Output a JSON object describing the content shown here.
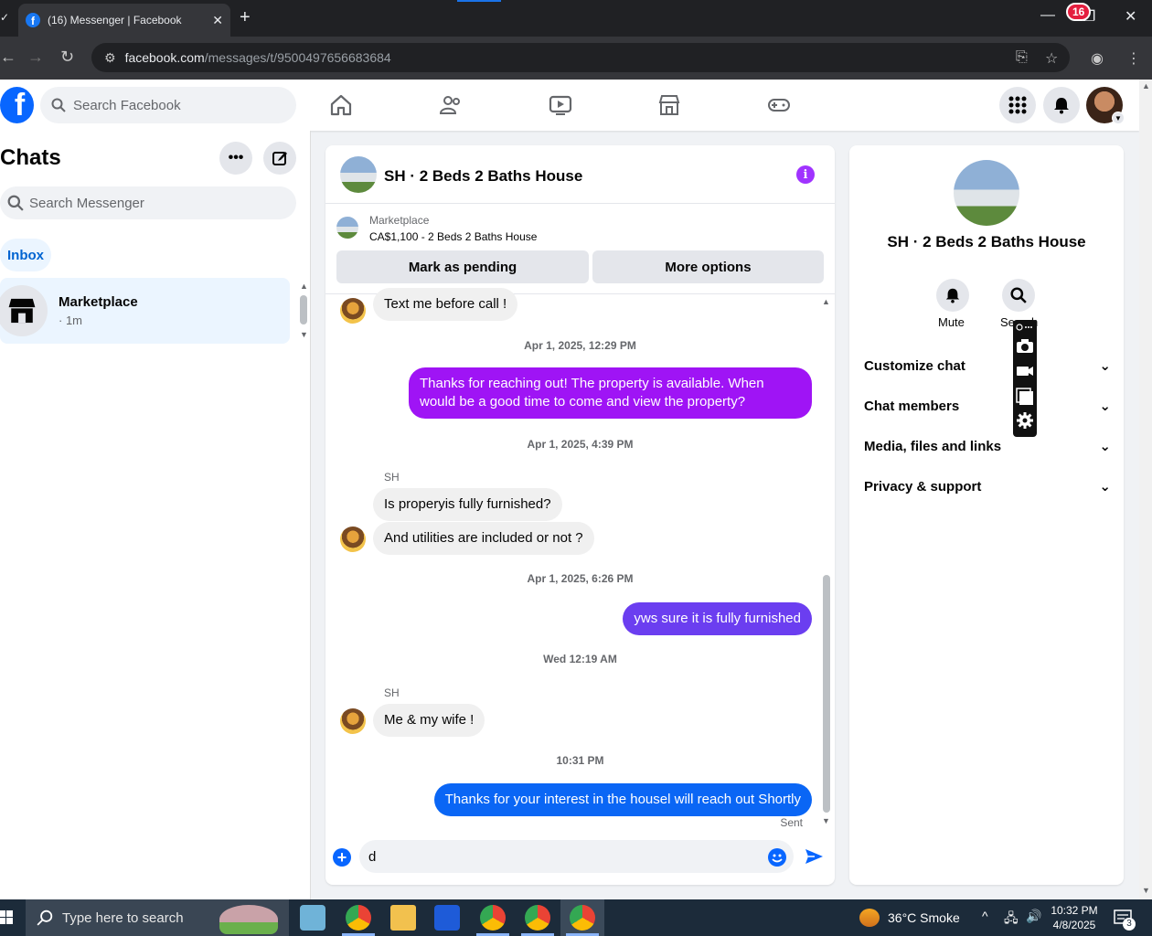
{
  "browser": {
    "tab_title": "(16) Messenger | Facebook",
    "url_host": "facebook.com",
    "url_path": "/messages/t/9500497656683684"
  },
  "fb_header": {
    "search_placeholder": "Search Facebook",
    "notification_count": "16"
  },
  "sidebar": {
    "title": "Chats",
    "search_placeholder": "Search Messenger",
    "inbox_label": "Inbox",
    "chats": [
      {
        "name": "Marketplace",
        "meta": "· 1m"
      }
    ]
  },
  "conversation": {
    "title": "SH · 2 Beds 2 Baths House",
    "marketplace_label": "Marketplace",
    "listing": "CA$1,100 - 2 Beds 2 Baths House",
    "mark_pending_label": "Mark as pending",
    "more_options_label": "More options",
    "messages": {
      "m1": "Text me before call !",
      "t1": "Apr 1, 2025, 12:29 PM",
      "m2": "Thanks for reaching out! The property is available. When would be a good time to come and view the property?",
      "t2": "Apr 1, 2025, 4:39 PM",
      "sender1": "SH",
      "m3": "Is properyis fully furnished?",
      "m4": "And utilities are included or not ?",
      "t3": "Apr 1, 2025, 6:26 PM",
      "m5": "yws sure it is fully furnished",
      "t4": "Wed 12:19 AM",
      "sender2": "SH",
      "m6": "Me & my wife !",
      "t5": "10:31 PM",
      "m7": "Thanks for your interest in the housel will reach out Shortly",
      "status": "Sent"
    },
    "composer_value": "d"
  },
  "right_panel": {
    "title": "SH · 2 Beds 2 Baths House",
    "mute_label": "Mute",
    "search_label": "Search",
    "sections": [
      "Customize chat",
      "Chat members",
      "Media, files and links",
      "Privacy & support"
    ]
  },
  "taskbar": {
    "search_placeholder": "Type here to search",
    "weather": "36°C  Smoke",
    "time": "10:32 PM",
    "date": "4/8/2025",
    "notification_count": "3"
  },
  "colors": {
    "fb_blue": "#0866ff",
    "out_purple": "#9f14f5",
    "out_violet": "#6b3ef0",
    "out_blue": "#0a66f5"
  }
}
